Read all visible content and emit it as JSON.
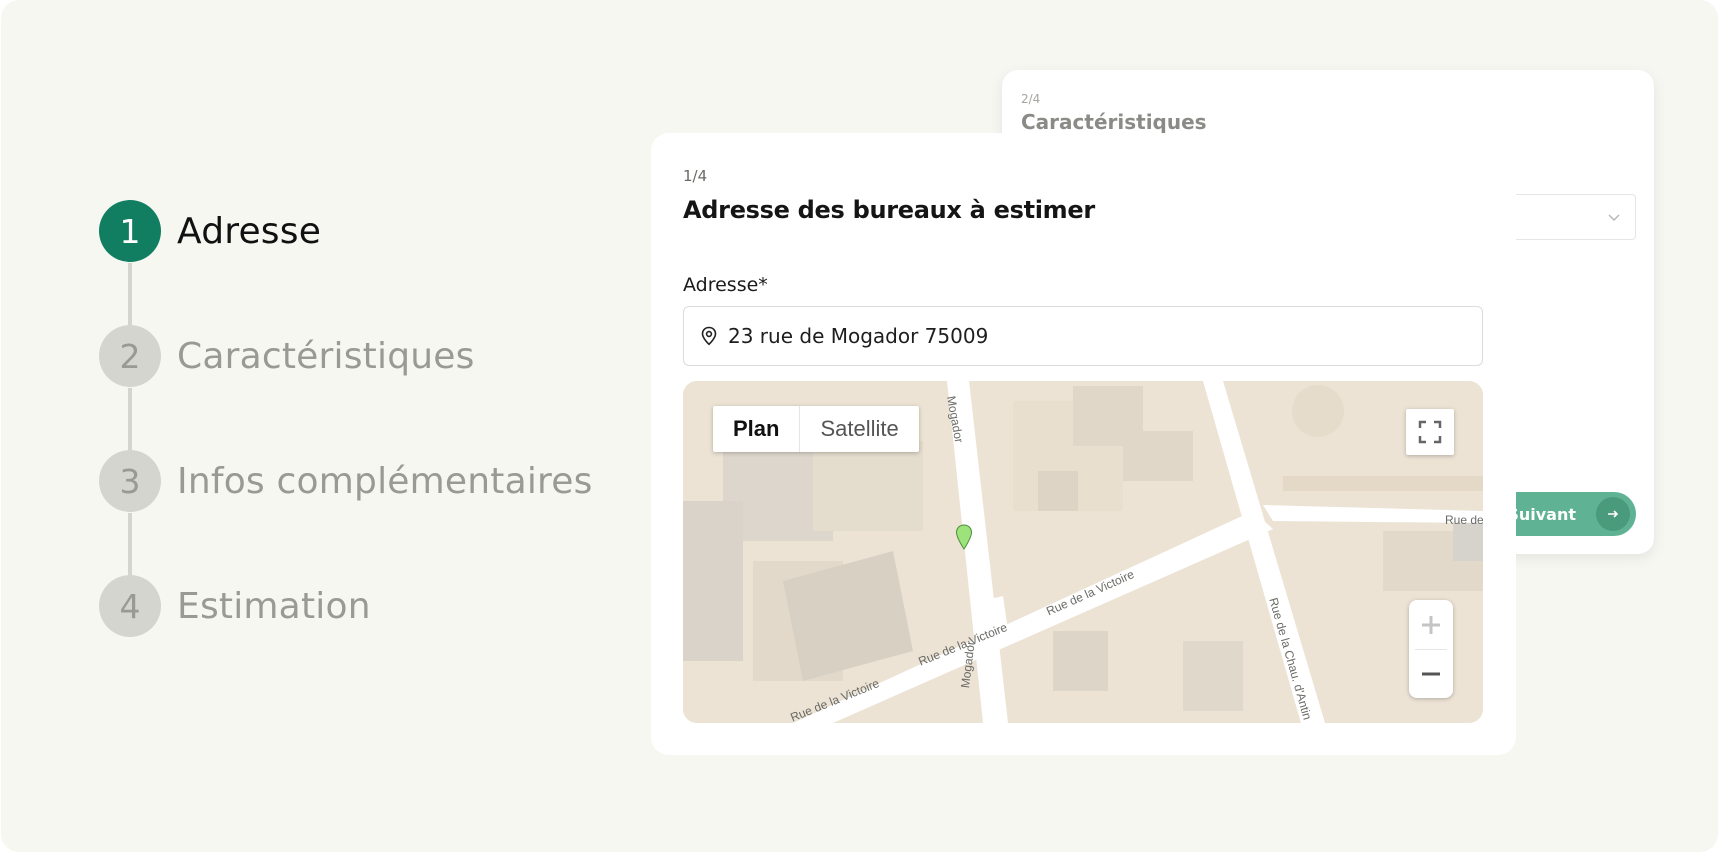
{
  "stepper": {
    "steps": [
      {
        "number": "1",
        "label": "Adresse",
        "active": true
      },
      {
        "number": "2",
        "label": "Caractéristiques",
        "active": false
      },
      {
        "number": "3",
        "label": "Infos complémentaires",
        "active": false
      },
      {
        "number": "4",
        "label": "Estimation",
        "active": false
      }
    ]
  },
  "back_card": {
    "step_count": "2/4",
    "title": "Caractéristiques",
    "next_label": "Suivant",
    "next_icon": "arrow-right-icon",
    "select_icon": "chevron-down-icon"
  },
  "front_card": {
    "step_count": "1/4",
    "title": "Adresse des bureaux à estimer",
    "address_label": "Adresse*",
    "address_value": "23 rue de Mogador 75009",
    "address_icon": "location-pin-icon"
  },
  "map": {
    "type_options": [
      "Plan",
      "Satellite"
    ],
    "selected_type": "Plan",
    "streets": {
      "mogador_top": "Mogador",
      "mogador_bottom": "Mogador",
      "victoire_left": "Rue de la Victoire",
      "victoire_mid": "Rue de la Victoire",
      "victoire_right": "Rue de la Victoire",
      "chau_dantin": "Rue de la Chau. d'Antin",
      "rue_de": "Rue de"
    },
    "controls": {
      "fullscreen_icon": "fullscreen-icon",
      "zoom_in_icon": "plus-icon",
      "zoom_out_icon": "minus-icon",
      "marker_icon": "map-marker-icon"
    },
    "colors": {
      "building": "#ece3d5",
      "street": "#ffffff",
      "marker": "#9be37a"
    }
  },
  "colors": {
    "accent": "#117e62",
    "button": "#5fb394",
    "inactive": "#9a9a95",
    "background": "#f7f7f2"
  }
}
